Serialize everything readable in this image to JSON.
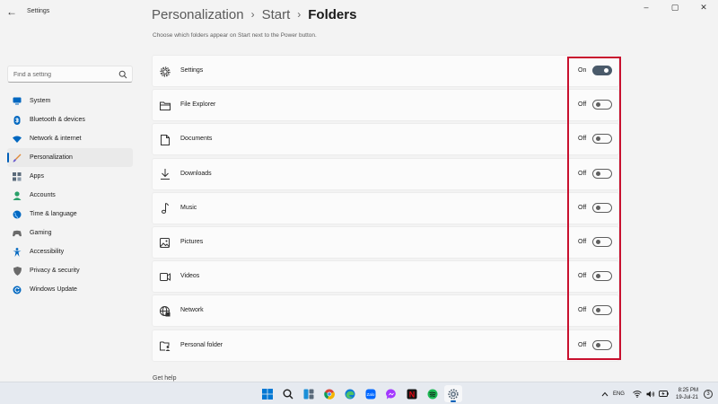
{
  "window": {
    "app_title": "Settings",
    "back_glyph": "←",
    "minimize_glyph": "–",
    "maximize_glyph": "▢",
    "close_glyph": "✕"
  },
  "search": {
    "placeholder": "Find a setting",
    "icon": "search-icon"
  },
  "sidebar": {
    "items": [
      {
        "label": "System",
        "icon": "system-icon",
        "color": "#0067c0"
      },
      {
        "label": "Bluetooth & devices",
        "icon": "bluetooth-icon",
        "color": "#0067c0"
      },
      {
        "label": "Network & internet",
        "icon": "wifi-icon",
        "color": "#0067c0"
      },
      {
        "label": "Personalization",
        "icon": "brush-icon",
        "color": "#e08a3a",
        "active": true
      },
      {
        "label": "Apps",
        "icon": "apps-icon",
        "color": "#5a6a7a"
      },
      {
        "label": "Accounts",
        "icon": "accounts-icon",
        "color": "#2aa06a"
      },
      {
        "label": "Time & language",
        "icon": "globe-icon",
        "color": "#0067c0"
      },
      {
        "label": "Gaming",
        "icon": "gaming-icon",
        "color": "#6a6a6a"
      },
      {
        "label": "Accessibility",
        "icon": "accessibility-icon",
        "color": "#0067c0"
      },
      {
        "label": "Privacy & security",
        "icon": "shield-icon",
        "color": "#6a6a6a"
      },
      {
        "label": "Windows Update",
        "icon": "update-icon",
        "color": "#0067c0"
      }
    ]
  },
  "main": {
    "breadcrumb": [
      "Personalization",
      "Start",
      "Folders"
    ],
    "breadcrumb_separator": "›",
    "subtitle": "Choose which folders appear on Start next to the Power button.",
    "folders": [
      {
        "label": "Settings",
        "icon": "gear-icon",
        "state": "On",
        "on": true
      },
      {
        "label": "File Explorer",
        "icon": "folder-icon",
        "state": "Off",
        "on": false
      },
      {
        "label": "Documents",
        "icon": "document-icon",
        "state": "Off",
        "on": false
      },
      {
        "label": "Downloads",
        "icon": "download-icon",
        "state": "Off",
        "on": false
      },
      {
        "label": "Music",
        "icon": "music-icon",
        "state": "Off",
        "on": false
      },
      {
        "label": "Pictures",
        "icon": "picture-icon",
        "state": "Off",
        "on": false
      },
      {
        "label": "Videos",
        "icon": "video-icon",
        "state": "Off",
        "on": false
      },
      {
        "label": "Network",
        "icon": "network-icon",
        "state": "Off",
        "on": false
      },
      {
        "label": "Personal folder",
        "icon": "personal-folder-icon",
        "state": "Off",
        "on": false
      }
    ],
    "footer_link": "Get help",
    "highlight_color": "#c8102e"
  },
  "taskbar": {
    "apps": [
      "windows-start-icon",
      "taskbar-search-icon",
      "widgets-icon",
      "chrome-icon",
      "edge-icon",
      "zalo-icon",
      "messenger-icon",
      "netflix-icon",
      "spotify-icon",
      "settings-app-icon"
    ],
    "zalo_text": "Zalo",
    "netflix_text": "N",
    "language": "ENG",
    "time": "8:25 PM",
    "date": "19-Jul-21",
    "notification_count": "3"
  }
}
